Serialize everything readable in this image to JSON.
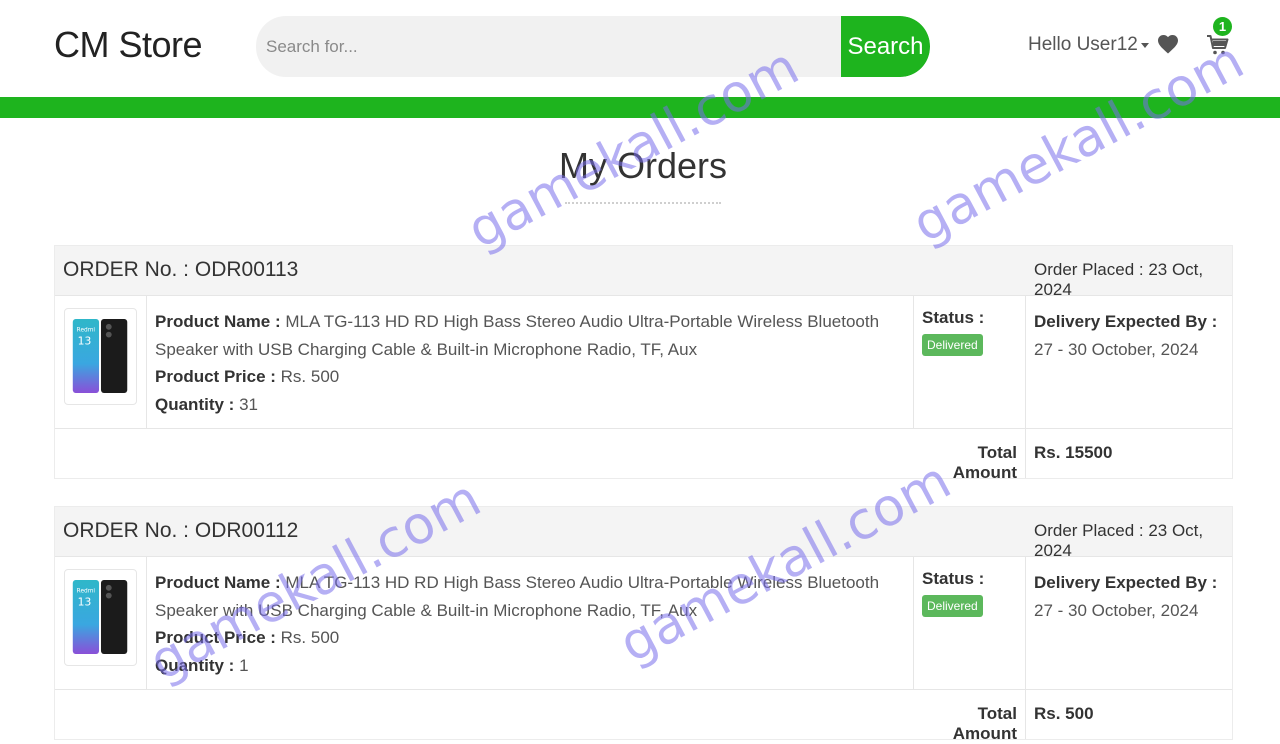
{
  "header": {
    "brand": "CM Store",
    "search_placeholder": "Search for...",
    "search_button": "Search",
    "user_greeting": "Hello User12",
    "cart_count": "1"
  },
  "page": {
    "title": "My Orders"
  },
  "orders": [
    {
      "order_label": "ORDER No. : ODR00113",
      "placed_label": "Order Placed : 23 Oct, 2024",
      "product_name_label": "Product Name :",
      "product_name": "MLA TG-113 HD RD High Bass Stereo Audio Ultra-Portable Wireless Bluetooth Speaker with USB Charging Cable & Built-in Microphone Radio, TF, Aux",
      "price_label": "Product Price :",
      "price": "Rs. 500",
      "quantity_label": "Quantity :",
      "quantity": "31",
      "status_label": "Status :",
      "status": "Delivered",
      "delivery_label": "Delivery Expected By :",
      "delivery": "27 - 30 October, 2024",
      "total_label": "Total Amount",
      "total": "Rs. 15500"
    },
    {
      "order_label": "ORDER No. : ODR00112",
      "placed_label": "Order Placed : 23 Oct, 2024",
      "product_name_label": "Product Name :",
      "product_name": "MLA TG-113 HD RD High Bass Stereo Audio Ultra-Portable Wireless Bluetooth Speaker with USB Charging Cable & Built-in Microphone Radio, TF, Aux",
      "price_label": "Product Price :",
      "price": "Rs. 500",
      "quantity_label": "Quantity :",
      "quantity": "1",
      "status_label": "Status :",
      "status": "Delivered",
      "delivery_label": "Delivery Expected By :",
      "delivery": "27 - 30 October, 2024",
      "total_label": "Total Amount",
      "total": "Rs. 500"
    }
  ],
  "watermark": {
    "text": "gamekall.com"
  },
  "colors": {
    "brand_green": "#1eb41e",
    "status_green": "#5cb85c",
    "watermark": "#786eeb"
  },
  "icons": [
    "heart-icon",
    "cart-icon",
    "caret-down-icon",
    "phone-thumbnail"
  ]
}
